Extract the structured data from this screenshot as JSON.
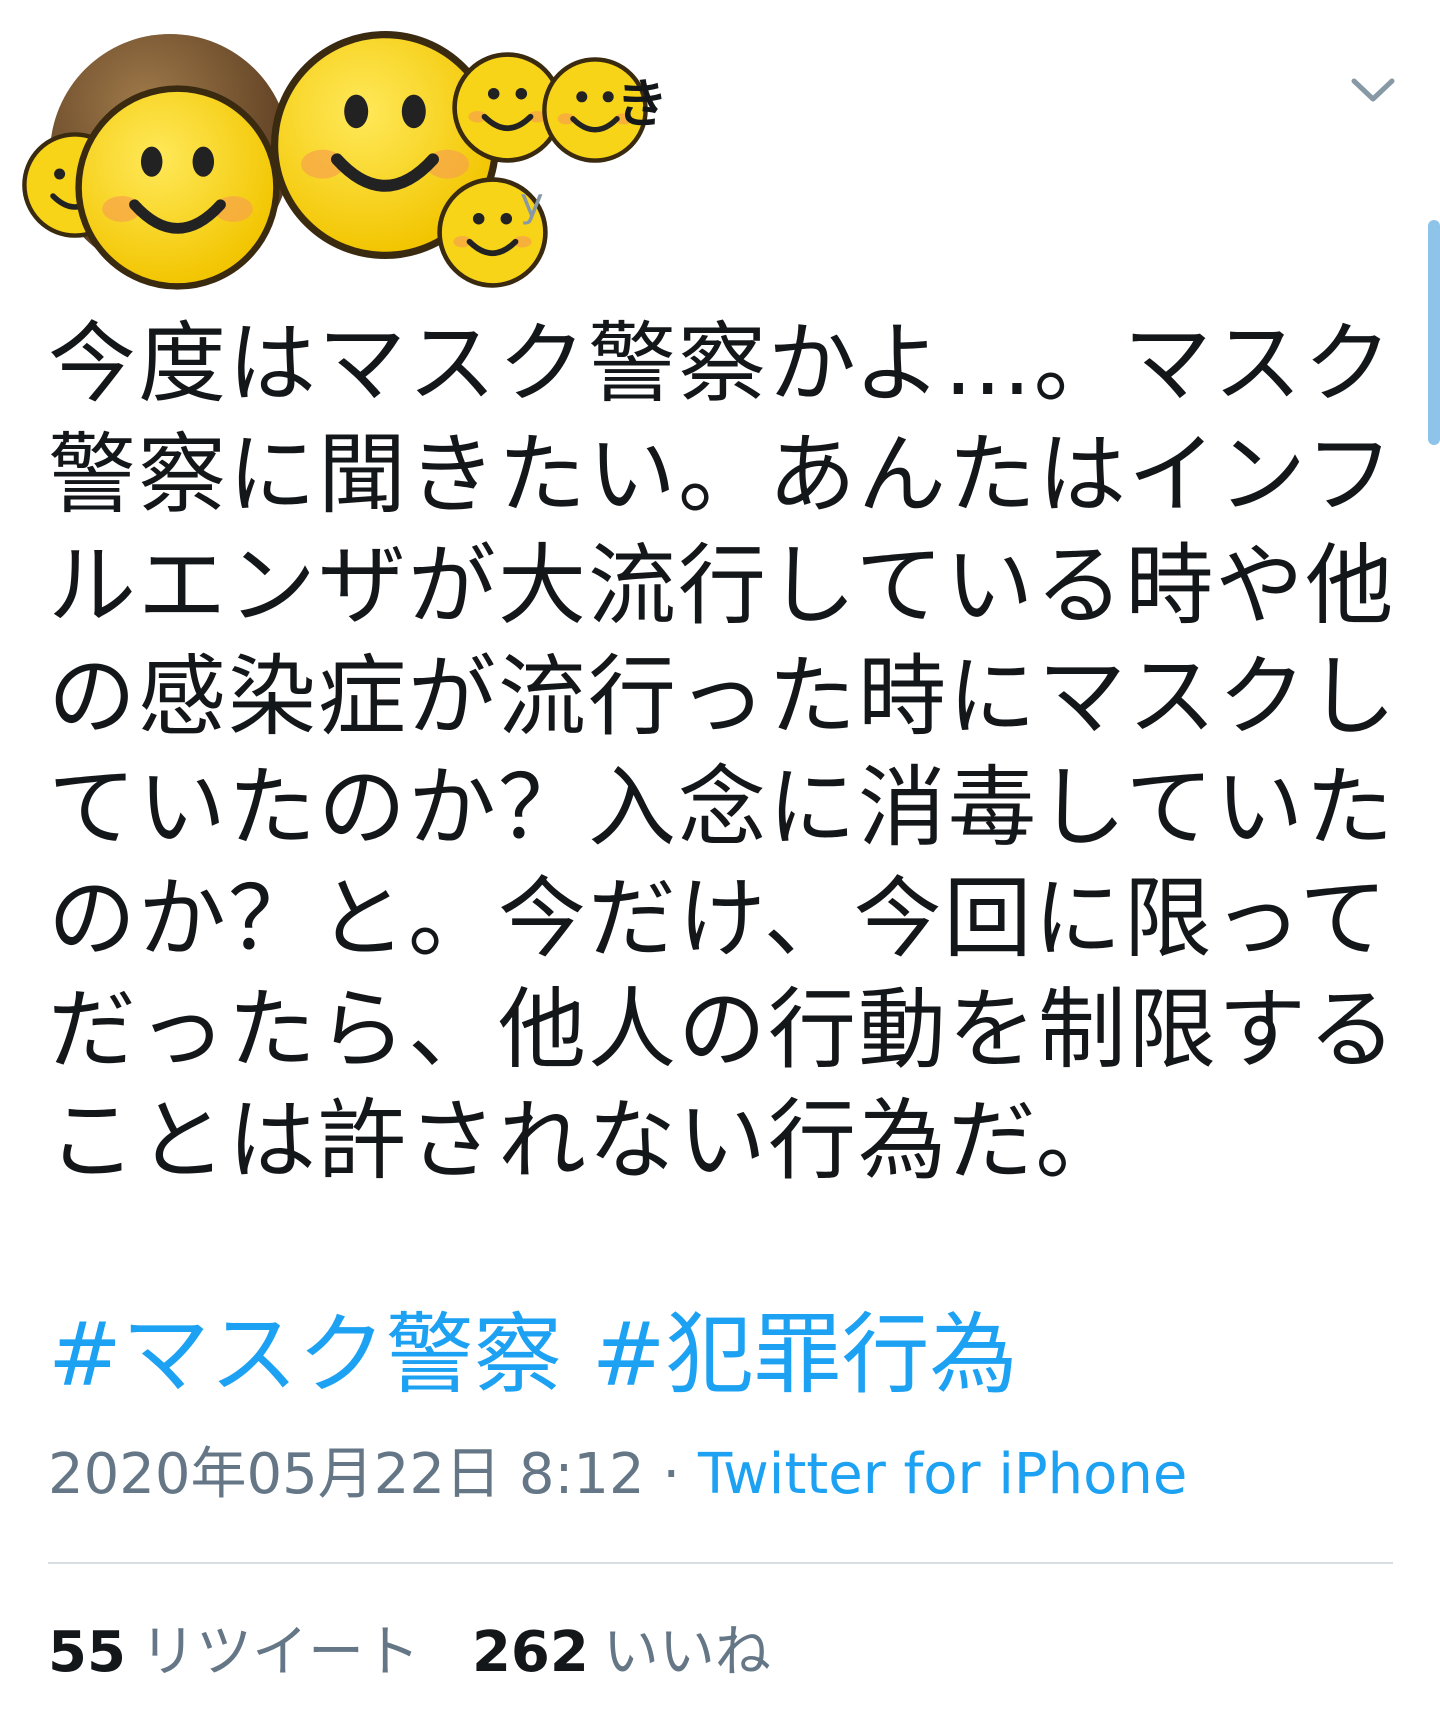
{
  "header": {
    "name_fragment": "き",
    "handle_fragment": "y",
    "menu_icon": "chevron-down-icon",
    "avatar_icon": "smiley-icon"
  },
  "tweet": {
    "lines": [
      "今度はマスク警察かよ…。マスク",
      "警察に聞きたい。あんたはインフ",
      "ルエンザが大流行している時や他",
      "の感染症が流行った時にマスクし",
      "ていたのか？入念に消毒していた",
      "のか？と。今だけ、今回に限って",
      "だったら、他人の行動を制限する",
      "ことは許されない行為だ。"
    ],
    "hashtags": [
      "#マスク警察",
      "#犯罪行為"
    ]
  },
  "meta": {
    "timestamp": "2020年05月22日 8:12",
    "separator": "·",
    "source": "Twitter for iPhone"
  },
  "stats": {
    "retweets_count": "55",
    "retweets_label": "リツイート",
    "likes_count": "262",
    "likes_label": "いいね"
  },
  "colors": {
    "link": "#1da1f2",
    "secondary_text": "#657786",
    "primary_text": "#14171a",
    "smiley": "#f7d418"
  }
}
